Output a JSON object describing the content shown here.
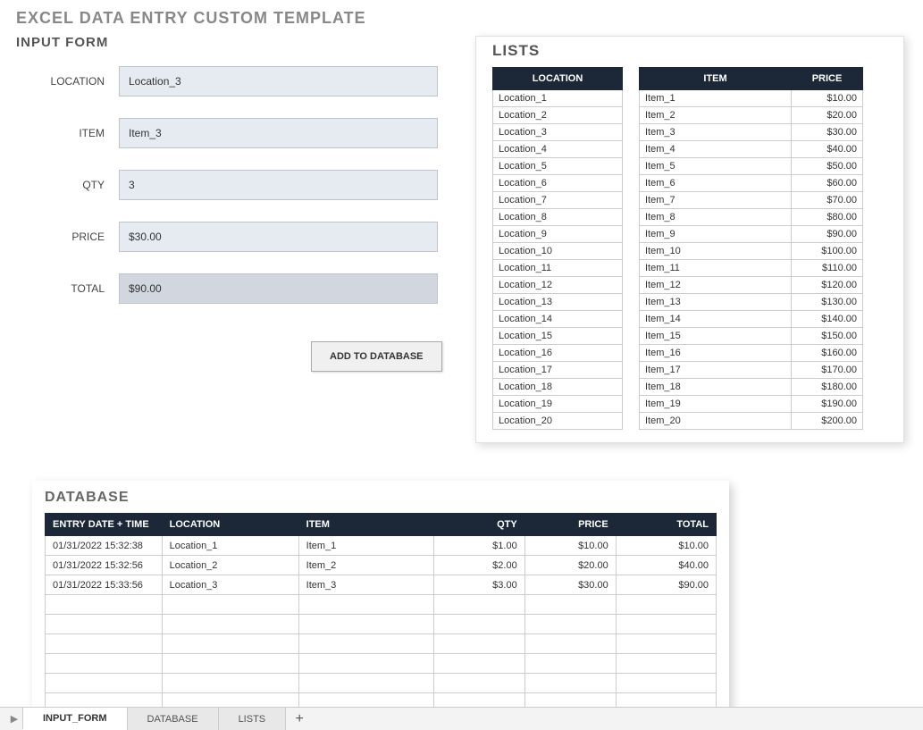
{
  "page_title": "EXCEL DATA ENTRY CUSTOM TEMPLATE",
  "form": {
    "title": "INPUT FORM",
    "labels": {
      "location": "LOCATION",
      "item": "ITEM",
      "qty": "QTY",
      "price": "PRICE",
      "total": "TOTAL"
    },
    "values": {
      "location": "Location_3",
      "item": "Item_3",
      "qty": "3",
      "price": "$30.00",
      "total": "$90.00"
    },
    "add_button": "ADD TO DATABASE"
  },
  "lists": {
    "title": "LISTS",
    "location_header": "LOCATION",
    "item_header": "ITEM",
    "price_header": "PRICE",
    "locations": [
      "Location_1",
      "Location_2",
      "Location_3",
      "Location_4",
      "Location_5",
      "Location_6",
      "Location_7",
      "Location_8",
      "Location_9",
      "Location_10",
      "Location_11",
      "Location_12",
      "Location_13",
      "Location_14",
      "Location_15",
      "Location_16",
      "Location_17",
      "Location_18",
      "Location_19",
      "Location_20"
    ],
    "items": [
      {
        "name": "Item_1",
        "price": "$10.00"
      },
      {
        "name": "Item_2",
        "price": "$20.00"
      },
      {
        "name": "Item_3",
        "price": "$30.00"
      },
      {
        "name": "Item_4",
        "price": "$40.00"
      },
      {
        "name": "Item_5",
        "price": "$50.00"
      },
      {
        "name": "Item_6",
        "price": "$60.00"
      },
      {
        "name": "Item_7",
        "price": "$70.00"
      },
      {
        "name": "Item_8",
        "price": "$80.00"
      },
      {
        "name": "Item_9",
        "price": "$90.00"
      },
      {
        "name": "Item_10",
        "price": "$100.00"
      },
      {
        "name": "Item_11",
        "price": "$110.00"
      },
      {
        "name": "Item_12",
        "price": "$120.00"
      },
      {
        "name": "Item_13",
        "price": "$130.00"
      },
      {
        "name": "Item_14",
        "price": "$140.00"
      },
      {
        "name": "Item_15",
        "price": "$150.00"
      },
      {
        "name": "Item_16",
        "price": "$160.00"
      },
      {
        "name": "Item_17",
        "price": "$170.00"
      },
      {
        "name": "Item_18",
        "price": "$180.00"
      },
      {
        "name": "Item_19",
        "price": "$190.00"
      },
      {
        "name": "Item_20",
        "price": "$200.00"
      }
    ]
  },
  "database": {
    "title": "DATABASE",
    "headers": {
      "entry": "ENTRY DATE + TIME",
      "location": "LOCATION",
      "item": "ITEM",
      "qty": "QTY",
      "price": "PRICE",
      "total": "TOTAL"
    },
    "rows": [
      {
        "entry": "01/31/2022 15:32:38",
        "location": "Location_1",
        "item": "Item_1",
        "qty": "$1.00",
        "price": "$10.00",
        "total": "$10.00"
      },
      {
        "entry": "01/31/2022 15:32:56",
        "location": "Location_2",
        "item": "Item_2",
        "qty": "$2.00",
        "price": "$20.00",
        "total": "$40.00"
      },
      {
        "entry": "01/31/2022 15:33:56",
        "location": "Location_3",
        "item": "Item_3",
        "qty": "$3.00",
        "price": "$30.00",
        "total": "$90.00"
      }
    ],
    "empty_rows": 6
  },
  "tabs": {
    "input_form": "INPUT_FORM",
    "database": "DATABASE",
    "lists": "LISTS"
  }
}
